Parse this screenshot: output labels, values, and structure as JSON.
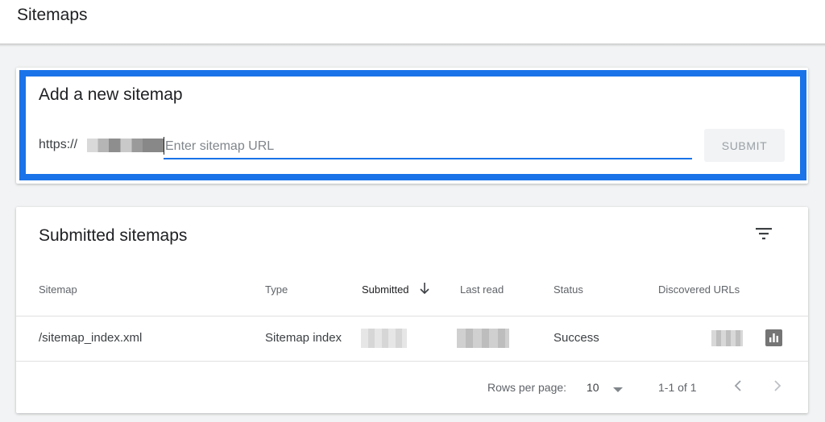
{
  "header": {
    "title": "Sitemaps"
  },
  "add_sitemap": {
    "title": "Add a new sitemap",
    "url_prefix": "https://",
    "input_placeholder": "Enter sitemap URL",
    "input_value": "",
    "submit_label": "SUBMIT"
  },
  "submitted": {
    "title": "Submitted sitemaps",
    "columns": {
      "sitemap": "Sitemap",
      "type": "Type",
      "submitted": "Submitted",
      "last_read": "Last read",
      "status": "Status",
      "discovered_urls": "Discovered URLs"
    },
    "sort_column": "Submitted",
    "sort_direction": "descending",
    "rows": [
      {
        "sitemap": "/sitemap_index.xml",
        "type": "Sitemap index",
        "status": "Success"
      }
    ],
    "pagination": {
      "rows_per_page_label": "Rows per page:",
      "rows_per_page_value": "10",
      "range": "1-1 of 1"
    }
  },
  "icons": {
    "filter": "filter-icon",
    "sort": "arrow-down-icon",
    "chart": "bar-chart-icon",
    "dropdown": "caret-down-icon",
    "prev": "chevron-left-icon",
    "next": "chevron-right-icon"
  },
  "colors": {
    "accent": "#1a73e8",
    "icon": "#757575"
  }
}
